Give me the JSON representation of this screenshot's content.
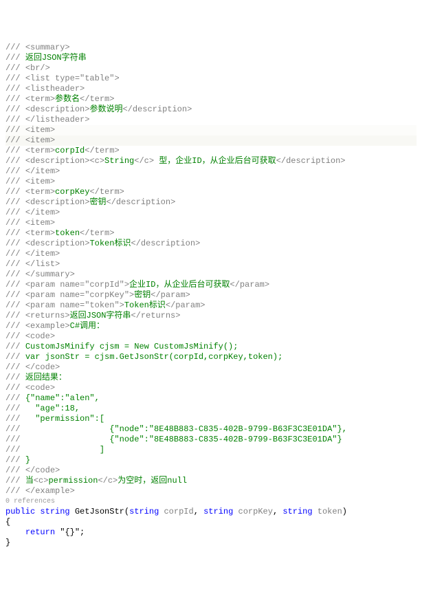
{
  "lines": [
    [
      {
        "t": "/// ",
        "c": "c-gray"
      },
      {
        "t": "<summary>",
        "c": "c-gray"
      }
    ],
    [
      {
        "t": "/// ",
        "c": "c-gray"
      },
      {
        "t": "返回JSON字符串",
        "c": "c-green"
      }
    ],
    [
      {
        "t": "/// ",
        "c": "c-gray"
      },
      {
        "t": "<br/>",
        "c": "c-gray"
      }
    ],
    [
      {
        "t": "/// ",
        "c": "c-gray"
      },
      {
        "t": "<list type=",
        "c": "c-gray"
      },
      {
        "t": "\"table\"",
        "c": "c-gray"
      },
      {
        "t": ">",
        "c": "c-gray"
      }
    ],
    [
      {
        "t": "/// ",
        "c": "c-gray"
      },
      {
        "t": "<listheader>",
        "c": "c-gray"
      }
    ],
    [
      {
        "t": "/// ",
        "c": "c-gray"
      },
      {
        "t": "<term>",
        "c": "c-gray"
      },
      {
        "t": "参数名",
        "c": "c-green"
      },
      {
        "t": "</term>",
        "c": "c-gray"
      }
    ],
    [
      {
        "t": "/// ",
        "c": "c-gray"
      },
      {
        "t": "<description>",
        "c": "c-gray"
      },
      {
        "t": "参数说明",
        "c": "c-green"
      },
      {
        "t": "</description>",
        "c": "c-gray"
      }
    ],
    [
      {
        "t": "/// ",
        "c": "c-gray"
      },
      {
        "t": "</listheader>",
        "c": "c-gray"
      }
    ],
    [
      {
        "t": "/// ",
        "c": "c-gray"
      },
      {
        "t": "<item>",
        "c": "c-gray"
      }
    ],
    [
      {
        "t": "/// ",
        "c": "c-gray"
      },
      {
        "t": "<item>",
        "c": "c-gray"
      }
    ],
    [
      {
        "t": "/// ",
        "c": "c-gray"
      },
      {
        "t": "<term>",
        "c": "c-gray"
      },
      {
        "t": "corpId",
        "c": "c-green"
      },
      {
        "t": "</term>",
        "c": "c-gray"
      }
    ],
    [
      {
        "t": "/// ",
        "c": "c-gray"
      },
      {
        "t": "<description>",
        "c": "c-gray"
      },
      {
        "t": "<c>",
        "c": "c-gray"
      },
      {
        "t": "String",
        "c": "c-green"
      },
      {
        "t": "</c>",
        "c": "c-gray"
      },
      {
        "t": " 型，企业ID，从企业后台可获取",
        "c": "c-green"
      },
      {
        "t": "</description>",
        "c": "c-gray"
      }
    ],
    [
      {
        "t": "/// ",
        "c": "c-gray"
      },
      {
        "t": "</item>",
        "c": "c-gray"
      }
    ],
    [
      {
        "t": "/// ",
        "c": "c-gray"
      },
      {
        "t": "<item>",
        "c": "c-gray"
      }
    ],
    [
      {
        "t": "/// ",
        "c": "c-gray"
      },
      {
        "t": "<term>",
        "c": "c-gray"
      },
      {
        "t": "corpKey",
        "c": "c-green"
      },
      {
        "t": "</term>",
        "c": "c-gray"
      }
    ],
    [
      {
        "t": "/// ",
        "c": "c-gray"
      },
      {
        "t": "<description>",
        "c": "c-gray"
      },
      {
        "t": "密钥",
        "c": "c-green"
      },
      {
        "t": "</description>",
        "c": "c-gray"
      }
    ],
    [
      {
        "t": "/// ",
        "c": "c-gray"
      },
      {
        "t": "</item>",
        "c": "c-gray"
      }
    ],
    [
      {
        "t": "/// ",
        "c": "c-gray"
      },
      {
        "t": "<item>",
        "c": "c-gray"
      }
    ],
    [
      {
        "t": "/// ",
        "c": "c-gray"
      },
      {
        "t": "<term>",
        "c": "c-gray"
      },
      {
        "t": "token",
        "c": "c-green"
      },
      {
        "t": "</term>",
        "c": "c-gray"
      }
    ],
    [
      {
        "t": "/// ",
        "c": "c-gray"
      },
      {
        "t": "<description>",
        "c": "c-gray"
      },
      {
        "t": "Token标识",
        "c": "c-green"
      },
      {
        "t": "</description>",
        "c": "c-gray"
      }
    ],
    [
      {
        "t": "/// ",
        "c": "c-gray"
      },
      {
        "t": "</item>",
        "c": "c-gray"
      }
    ],
    [
      {
        "t": "/// ",
        "c": "c-gray"
      },
      {
        "t": "</list>",
        "c": "c-gray"
      }
    ],
    [
      {
        "t": "/// ",
        "c": "c-gray"
      },
      {
        "t": "</summary>",
        "c": "c-gray"
      }
    ],
    [
      {
        "t": "/// ",
        "c": "c-gray"
      },
      {
        "t": "<param name=",
        "c": "c-gray"
      },
      {
        "t": "\"corpId\"",
        "c": "c-gray"
      },
      {
        "t": ">",
        "c": "c-gray"
      },
      {
        "t": "企业ID，从企业后台可获取",
        "c": "c-green"
      },
      {
        "t": "</param>",
        "c": "c-gray"
      }
    ],
    [
      {
        "t": "/// ",
        "c": "c-gray"
      },
      {
        "t": "<param name=",
        "c": "c-gray"
      },
      {
        "t": "\"corpKey\"",
        "c": "c-gray"
      },
      {
        "t": ">",
        "c": "c-gray"
      },
      {
        "t": "密钥",
        "c": "c-green"
      },
      {
        "t": "</param>",
        "c": "c-gray"
      }
    ],
    [
      {
        "t": "/// ",
        "c": "c-gray"
      },
      {
        "t": "<param name=",
        "c": "c-gray"
      },
      {
        "t": "\"token\"",
        "c": "c-gray"
      },
      {
        "t": ">",
        "c": "c-gray"
      },
      {
        "t": "Token标识",
        "c": "c-green"
      },
      {
        "t": "</param>",
        "c": "c-gray"
      }
    ],
    [
      {
        "t": "/// ",
        "c": "c-gray"
      },
      {
        "t": "<returns>",
        "c": "c-gray"
      },
      {
        "t": "返回JSON字符串",
        "c": "c-green"
      },
      {
        "t": "</returns>",
        "c": "c-gray"
      }
    ],
    [
      {
        "t": "/// ",
        "c": "c-gray"
      },
      {
        "t": "<example>",
        "c": "c-gray"
      },
      {
        "t": "C#调用：",
        "c": "c-green"
      }
    ],
    [
      {
        "t": "/// ",
        "c": "c-gray"
      },
      {
        "t": "<code>",
        "c": "c-gray"
      }
    ],
    [
      {
        "t": "/// ",
        "c": "c-gray"
      },
      {
        "t": "CustomJsMinify cjsm = New CustomJsMinify();",
        "c": "c-green"
      }
    ],
    [
      {
        "t": "/// ",
        "c": "c-gray"
      },
      {
        "t": "var jsonStr = cjsm.GetJsonStr(corpId,corpKey,token);",
        "c": "c-green"
      }
    ],
    [
      {
        "t": "/// ",
        "c": "c-gray"
      },
      {
        "t": "</code>",
        "c": "c-gray"
      }
    ],
    [
      {
        "t": "/// ",
        "c": "c-gray"
      },
      {
        "t": "返回结果：",
        "c": "c-green"
      }
    ],
    [
      {
        "t": "/// ",
        "c": "c-gray"
      },
      {
        "t": "<code>",
        "c": "c-gray"
      }
    ],
    [
      {
        "t": "/// ",
        "c": "c-gray"
      },
      {
        "t": "{\"name\":\"alen\",",
        "c": "c-green"
      }
    ],
    [
      {
        "t": "///   ",
        "c": "c-gray"
      },
      {
        "t": "\"age\":18,",
        "c": "c-green"
      }
    ],
    [
      {
        "t": "///   ",
        "c": "c-gray"
      },
      {
        "t": "\"permission\":[",
        "c": "c-green"
      }
    ],
    [
      {
        "t": "///                  ",
        "c": "c-gray"
      },
      {
        "t": "{\"node\":\"8E48B883-C835-402B-9799-B63F3C3E01DA\"},",
        "c": "c-green"
      }
    ],
    [
      {
        "t": "///                  ",
        "c": "c-gray"
      },
      {
        "t": "{\"node\":\"8E48B883-C835-402B-9799-B63F3C3E01DA\"}",
        "c": "c-green"
      }
    ],
    [
      {
        "t": "///                ",
        "c": "c-gray"
      },
      {
        "t": "]",
        "c": "c-green"
      }
    ],
    [
      {
        "t": "/// ",
        "c": "c-gray"
      },
      {
        "t": "}",
        "c": "c-green"
      }
    ],
    [
      {
        "t": "/// ",
        "c": "c-gray"
      },
      {
        "t": "</code>",
        "c": "c-gray"
      }
    ],
    [
      {
        "t": "/// ",
        "c": "c-gray"
      },
      {
        "t": "当",
        "c": "c-green"
      },
      {
        "t": "<c>",
        "c": "c-gray"
      },
      {
        "t": "permission",
        "c": "c-green"
      },
      {
        "t": "</c>",
        "c": "c-gray"
      },
      {
        "t": "为空时，返回null",
        "c": "c-green"
      }
    ],
    [
      {
        "t": "/// ",
        "c": "c-gray"
      },
      {
        "t": "</example>",
        "c": "c-gray"
      }
    ]
  ],
  "highlights": {
    "8": "hl1",
    "9": "hl2"
  },
  "refcount": "0 references",
  "sig": [
    {
      "t": "public",
      "c": "c-blue"
    },
    {
      "t": " ",
      "c": "c-black"
    },
    {
      "t": "string",
      "c": "c-blue"
    },
    {
      "t": " ",
      "c": "c-black"
    },
    {
      "t": "GetJsonStr(",
      "c": "c-black"
    },
    {
      "t": "string",
      "c": "c-blue"
    },
    {
      "t": " ",
      "c": "c-black"
    },
    {
      "t": "corpId",
      "c": "c-gray"
    },
    {
      "t": ", ",
      "c": "c-black"
    },
    {
      "t": "string",
      "c": "c-blue"
    },
    {
      "t": " ",
      "c": "c-black"
    },
    {
      "t": "corpKey",
      "c": "c-gray"
    },
    {
      "t": ", ",
      "c": "c-black"
    },
    {
      "t": "string",
      "c": "c-blue"
    },
    {
      "t": " ",
      "c": "c-black"
    },
    {
      "t": "token",
      "c": "c-gray"
    },
    {
      "t": ")",
      "c": "c-black"
    }
  ],
  "body": [
    [
      {
        "t": "{",
        "c": "c-black"
      }
    ],
    [
      {
        "t": "    ",
        "c": "c-black"
      },
      {
        "t": "return",
        "c": "c-blue"
      },
      {
        "t": " ",
        "c": "c-black"
      },
      {
        "t": "\"{}\"",
        "c": "c-black"
      },
      {
        "t": ";",
        "c": "c-black"
      }
    ],
    [
      {
        "t": "}",
        "c": "c-black"
      }
    ]
  ]
}
